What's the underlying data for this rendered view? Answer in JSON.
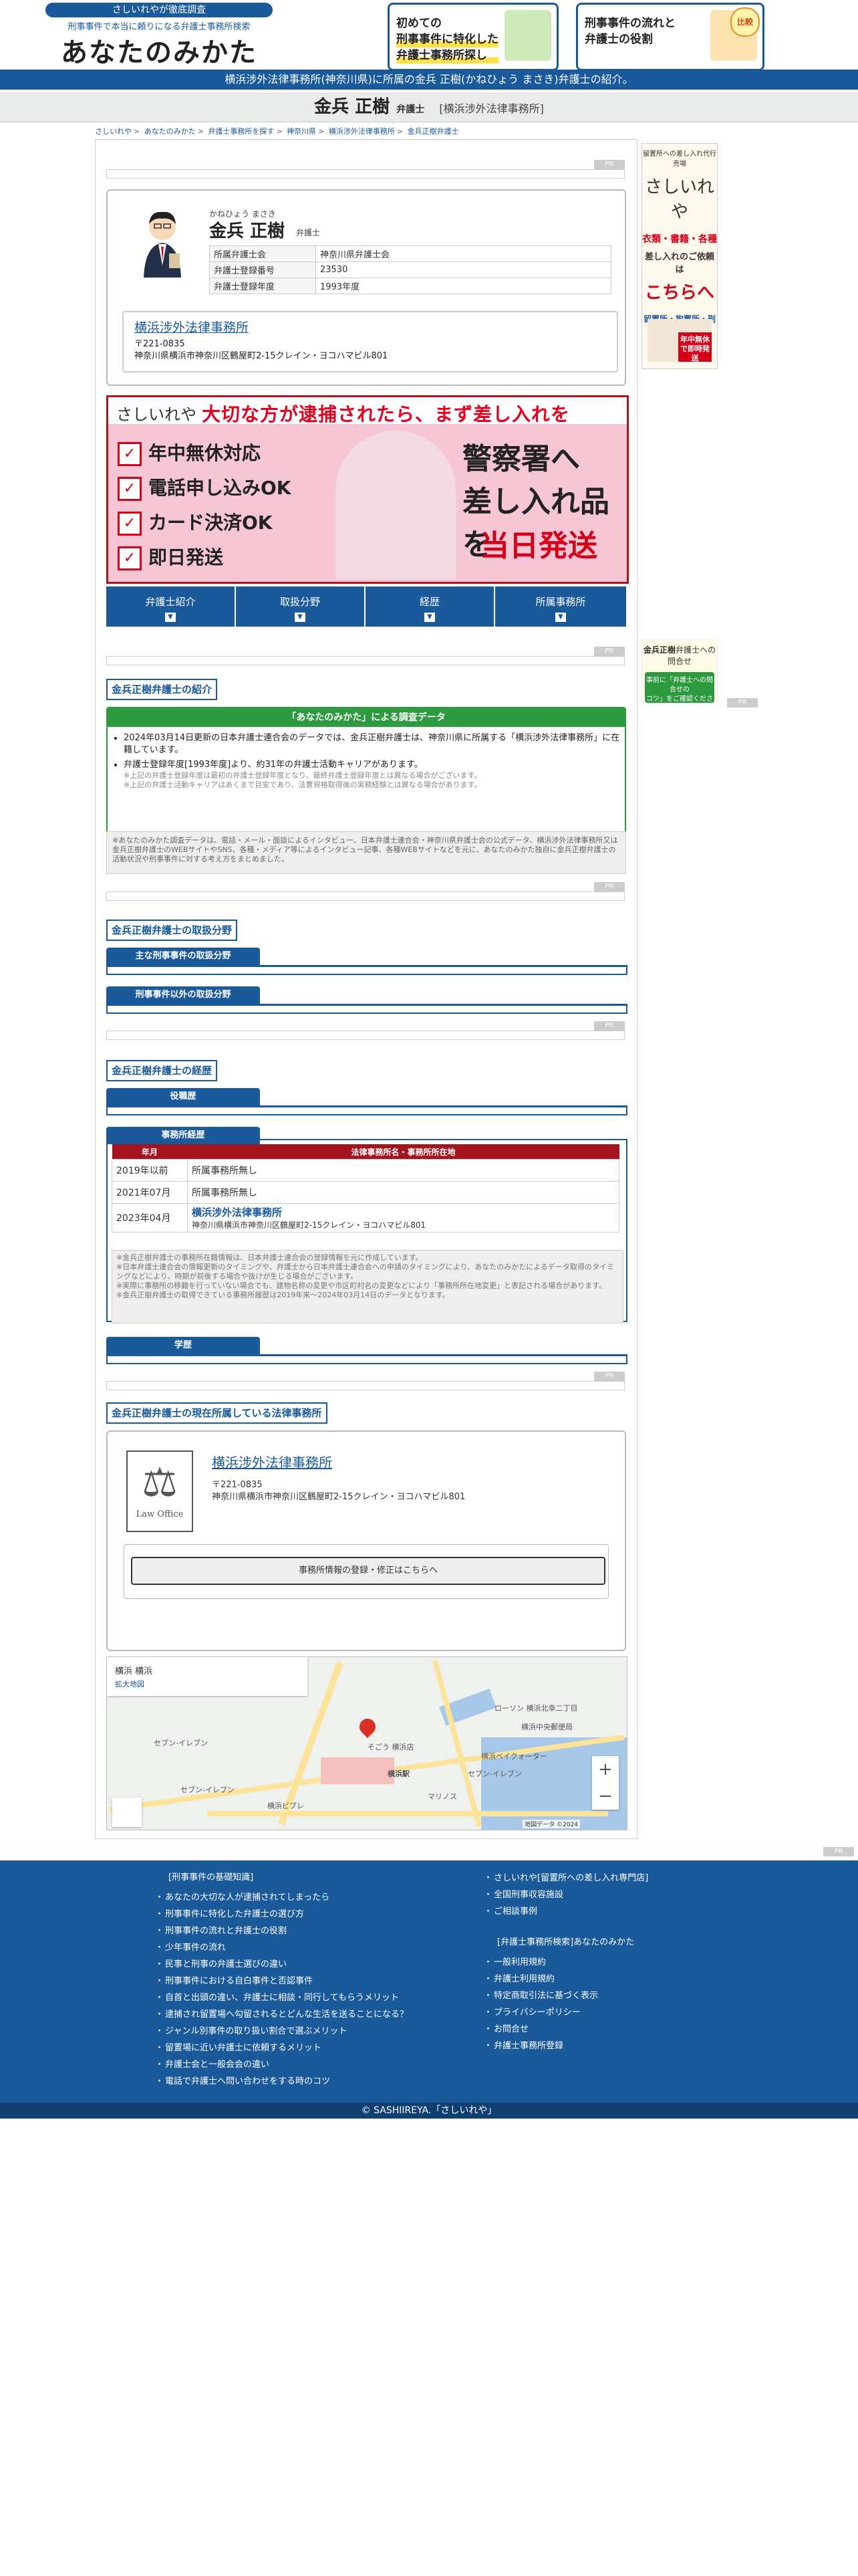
{
  "header": {
    "logo_top": "さしいれやが徹底調査",
    "logo_sub": "刑事事件で本当に頼りになる弁護士事務所検索",
    "logo_main": "あなたのみかた",
    "banner1_line1": "初めての",
    "banner1_line2": "刑事事件に特化した",
    "banner1_line3": "弁護士事務所探し",
    "banner2_line1": "刑事事件の流れと",
    "banner2_line2": "弁護士の役割",
    "banner2_badge": "比較"
  },
  "top_bar": "横浜涉外法律事務所(神奈川県)に所属の金兵 正樹(かねひょう まさき)弁護士の紹介。",
  "title": {
    "name": "金兵 正樹",
    "role": "弁護士",
    "firm": "[横浜涉外法律事務所]"
  },
  "breadcrumb": [
    "さしいれや",
    "あなたのみかた",
    "弁護士事務所を探す",
    "神奈川県",
    "横浜涉外法律事務所",
    "金兵正樹弁護士"
  ],
  "pr_label": "PR",
  "profile": {
    "kana": "かねひょう まさき",
    "name": "金兵 正樹",
    "role": "弁護士",
    "rows": [
      {
        "k": "所属弁護士会",
        "v": "神奈川県弁護士会"
      },
      {
        "k": "弁護士登録番号",
        "v": "23530"
      },
      {
        "k": "弁護士登録年度",
        "v": "1993年度"
      }
    ],
    "office_name": "横浜涉外法律事務所",
    "office_zip": "〒221-0835",
    "office_addr": "神奈川県横浜市神奈川区鶴屋町2-15クレイン・ヨコハマビル801"
  },
  "ad": {
    "brand": "さしいれや",
    "headline": "大切な方が逮捕されたら、まず差し入れを",
    "checks": [
      "年中無休対応",
      "電話申し込みOK",
      "カード決済OK",
      "即日発送"
    ],
    "big1": "警察署へ",
    "big2": "差し入れ品を",
    "big3": "当日発送"
  },
  "tabs": [
    "弁護士紹介",
    "取扱分野",
    "経歴",
    "所属事務所"
  ],
  "intro": {
    "title": "金兵正樹弁護士の紹介",
    "box_head": "「あなたのみかた」による調査データ",
    "item1": "2024年03月14日更新の日本弁護士連合会のデータでは、金兵正樹弁護士は、神奈川県に所属する「横浜涉外法律事務所」に在籍しています。",
    "item2": "弁護士登録年度[1993年度]より、約31年の弁護士活動キャリアがあります。",
    "note2a": "※上記の弁護士登録年度は最初の弁護士登録年度となり、最終弁護士登録年度とは異なる場合がございます。",
    "note2b": "※上記の弁護士活動キャリアはあくまで目安であり、法曹資格取得後の実務経験とは異なる場合があります。",
    "disclaimer": "※あなたのみかた調査データは、電話・メール・面談によるインタビュー、日本弁護士連合会・神奈川県弁護士会の公式データ、横浜涉外法律事務所又は金兵正樹弁護士のWEBサイトやSNS、各種・メディア等によるインタビュー記事、各種WEBサイトなどを元に、あなたのみかた独自に金兵正樹弁護士の活動状況や刑事事件に対する考え方をまとめました。"
  },
  "fields": {
    "title": "金兵正樹弁護士の取扱分野",
    "sub1": "主な刑事事件の取扱分野",
    "sub2": "刑事事件以外の取扱分野"
  },
  "career": {
    "title": "金兵正樹弁護士の経歴",
    "sub1": "役職歴",
    "sub2": "事務所経歴",
    "col_year": "年月",
    "col_office": "法律事務所名・事務所所在地",
    "rows": [
      {
        "year": "2019年以前",
        "office": "所属事務所無し",
        "addr": ""
      },
      {
        "year": "2021年07月",
        "office": "所属事務所無し",
        "addr": ""
      },
      {
        "year": "2023年04月",
        "office": "横浜涉外法律事務所",
        "addr": "神奈川県横浜市神奈川区鶴屋町2-15クレイン・ヨコハマビル801"
      }
    ],
    "note1": "※金兵正樹弁護士の事務所在籍情報は、日本弁護士連合会の登録情報を元に作成しています。",
    "note2": "※日本弁護士連合会の情報更新のタイミングや、弁護士から日本弁護士連合会への申請のタイミングにより、あなたのみかたによるデータ取得のタイミングなどにより、時期が前後する場合や抜けが生じる場合がございます。",
    "note3": "※実際に事務所の移籍を行っていない場合でも、建物名称の変更や市区町村名の変更などにより「事務所所在地変更」と表記される場合があります。",
    "note4": "※金兵正樹弁護士の取得できている事務所履歴は2019年来〜2024年03月14日のデータとなります。",
    "sub3": "学歴"
  },
  "firm": {
    "title": "金兵正樹弁護士の現在所属している法律事務所",
    "logo_text": "Law Office",
    "name": "横浜涉外法律事務所",
    "zip": "〒221-0835",
    "addr": "神奈川県横浜市神奈川区鶴屋町2-15クレイン・ヨコハマビル801",
    "button": "事務所情報の登録・修正はこちらへ"
  },
  "map": {
    "card_line1": "横浜 横浜",
    "card_line2": "拡大地図",
    "labels": [
      "ローソン 横浜北幸二丁目",
      "セブン-イレブン",
      "横浜中央郵便局",
      "横浜ベイクォーター",
      "セブン-イレブン",
      "そごう 横浜店",
      "横浜駅",
      "セブン-イレブン",
      "横浜ビブレ",
      "マリノス"
    ],
    "zoom_in": "+",
    "zoom_out": "−",
    "footer": "地図データ ©2024"
  },
  "side": {
    "top": "留置所への差し入れ代行売場",
    "brand": "さしいれや",
    "items": "衣類・書籍・各種",
    "ask": "差し入れのご依頼は",
    "big": "こちらへ",
    "row": "留置所・拘置所・刑務所",
    "tag": "年中無休で即時発送",
    "contact_title_name": "金兵正樹",
    "contact_title_rest": "弁護士への問合せ",
    "contact_btn_line1": "事前に「弁護士への問合せの",
    "contact_btn_line2": "コツ」をご確認ください"
  },
  "footer": {
    "col1_head": "[刑事事件の基礎知識]",
    "col1": [
      "あなたの大切な人が逮捕されてしまったら",
      "刑事事件に特化した弁護士の選び方",
      "刑事事件の流れと弁護士の役割",
      "少年事件の流れ",
      "民事と刑事の弁護士選びの違い",
      "刑事事件における自白事件と否認事件",
      "自首と出頭の違い、弁護士に相談・同行してもらうメリット",
      "逮捕され留置場へ勾留されるとどんな生活を送ることになる？",
      "ジャンル別事件の取り扱い割合で選ぶメリット",
      "留置場に近い弁護士に依頼するメリット",
      "弁護士会と一般会会の違い",
      "電話で弁護士へ問い合わせをする時のコツ"
    ],
    "col2": [
      "さしいれや[留置所への差し入れ専門店]",
      "全国刑事収容施設",
      "ご相談事例"
    ],
    "col3_head": "[弁護士事務所検索]あなたのみかた",
    "col3": [
      "一般利用規約",
      "弁護士利用規約",
      "特定商取引法に基づく表示",
      "プライバシーポリシー",
      "お問合せ",
      "弁護士事務所登録"
    ]
  },
  "copyright": "© SASHIIREYA.「さしいれや」"
}
